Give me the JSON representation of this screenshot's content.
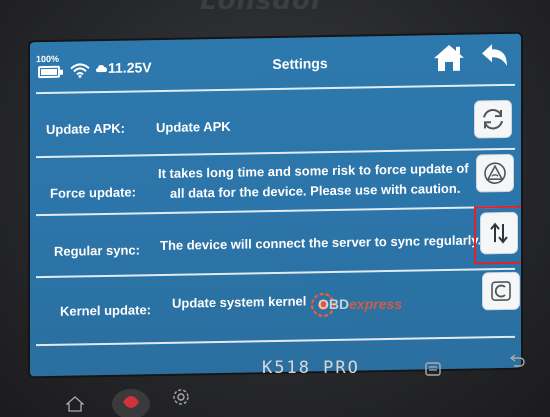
{
  "device": {
    "brand": "Lonsdor",
    "model": "K518 PRO"
  },
  "status_bar": {
    "battery": "100%",
    "voltage": "11.25V",
    "title": "Settings",
    "icons": [
      "battery-icon",
      "wifi-icon",
      "cloud-icon",
      "home-icon",
      "back-icon"
    ]
  },
  "rows": [
    {
      "label": "Update APK:",
      "description": "Update APK",
      "button_icon": "refresh-apk-icon"
    },
    {
      "label": "Force update:",
      "description_line1": "It takes long time and some risk to force update of",
      "description_line2": "all data for the device. Please use with caution.",
      "button_icon": "force-update-icon"
    },
    {
      "label": "Regular sync:",
      "description": "The device will connect the server to sync regularly.",
      "button_icon": "sync-arrows-icon"
    },
    {
      "label": "Kernel update:",
      "description": "Update system kernel",
      "button_icon": "kernel-update-icon"
    }
  ],
  "watermark": {
    "prefix": "OBD",
    "suffix": "express"
  },
  "colors": {
    "screen_blue": "#2c75aa",
    "highlight_red": "#e2202a",
    "button_bg": "#f4f6f8"
  }
}
